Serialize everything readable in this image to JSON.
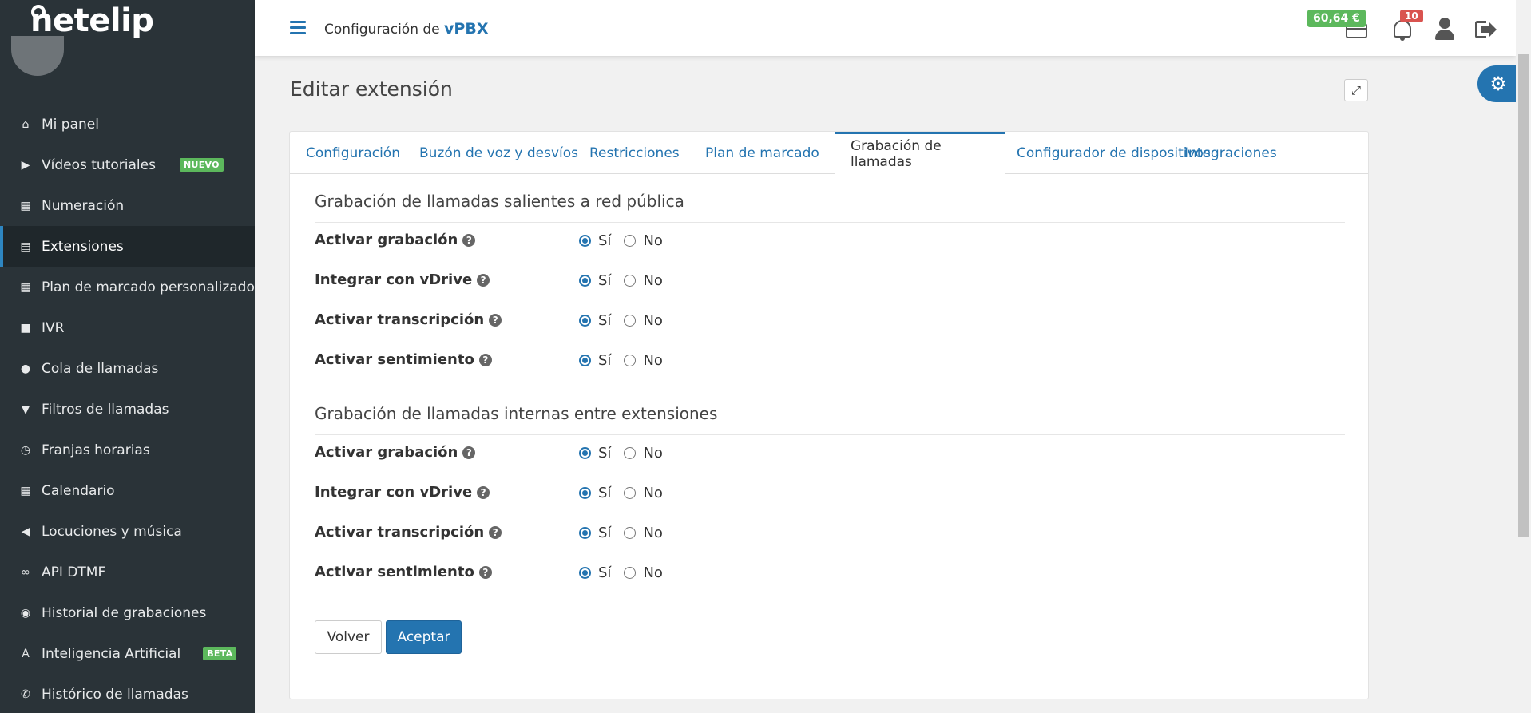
{
  "brand": {
    "logo_text": "netelip"
  },
  "sidebar": {
    "items": [
      {
        "label": "Mi panel",
        "icon": "home-icon",
        "glyph": "⌂"
      },
      {
        "label": "Vídeos tutoriales",
        "icon": "video-icon",
        "glyph": "▶",
        "badge": "NUEVO"
      },
      {
        "label": "Numeración",
        "icon": "grid-icon",
        "glyph": "▦"
      },
      {
        "label": "Extensiones",
        "icon": "list-icon",
        "glyph": "▤",
        "active": true
      },
      {
        "label": "Plan de marcado personalizado",
        "icon": "apps-icon",
        "glyph": "▦"
      },
      {
        "label": "IVR",
        "icon": "chat-icon",
        "glyph": "■"
      },
      {
        "label": "Cola de llamadas",
        "icon": "user-icon",
        "glyph": "●"
      },
      {
        "label": "Filtros de llamadas",
        "icon": "filter-icon",
        "glyph": "▼"
      },
      {
        "label": "Franjas horarias",
        "icon": "clock-icon",
        "glyph": "◷"
      },
      {
        "label": "Calendario",
        "icon": "calendar-icon",
        "glyph": "▦"
      },
      {
        "label": "Locuciones y música",
        "icon": "volume-icon",
        "glyph": "◀"
      },
      {
        "label": "API DTMF",
        "icon": "link-icon",
        "glyph": "∞"
      },
      {
        "label": "Historial de grabaciones",
        "icon": "record-icon",
        "glyph": "◉"
      },
      {
        "label": "Inteligencia Artificial",
        "icon": "ai-icon",
        "glyph": "A",
        "badge": "BETA"
      },
      {
        "label": "Histórico de llamadas",
        "icon": "phone-icon",
        "glyph": "✆"
      }
    ]
  },
  "topbar": {
    "title_prefix": "Configuración de ",
    "title_brand": "vPBX",
    "balance": "60,64 €",
    "notifications_count": "10"
  },
  "page": {
    "title": "Editar extensión",
    "tabs": [
      {
        "label": "Configuración"
      },
      {
        "label": "Buzón de voz y desvíos"
      },
      {
        "label": "Restricciones"
      },
      {
        "label": "Plan de marcado"
      },
      {
        "label": "Grabación de llamadas",
        "active": true
      },
      {
        "label": "Configurador de dispositivos"
      },
      {
        "label": "Integraciones"
      }
    ],
    "sections": [
      {
        "title": "Grabación de llamadas salientes a red pública",
        "rows": [
          {
            "label": "Activar grabación",
            "value": "Sí"
          },
          {
            "label": "Integrar con vDrive",
            "value": "Sí"
          },
          {
            "label": "Activar transcripción",
            "value": "Sí"
          },
          {
            "label": "Activar sentimiento",
            "value": "Sí"
          }
        ]
      },
      {
        "title": "Grabación de llamadas internas entre extensiones",
        "rows": [
          {
            "label": "Activar grabación",
            "value": "Sí"
          },
          {
            "label": "Integrar con vDrive",
            "value": "Sí"
          },
          {
            "label": "Activar transcripción",
            "value": "Sí"
          },
          {
            "label": "Activar sentimiento",
            "value": "Sí"
          }
        ]
      }
    ],
    "options": {
      "yes": "Sí",
      "no": "No"
    },
    "buttons": {
      "back": "Volver",
      "accept": "Aceptar"
    }
  },
  "colors": {
    "sidebar_bg": "#2a3338",
    "accent": "#2474b0",
    "success": "#5cb85c",
    "danger": "#d9534f"
  }
}
